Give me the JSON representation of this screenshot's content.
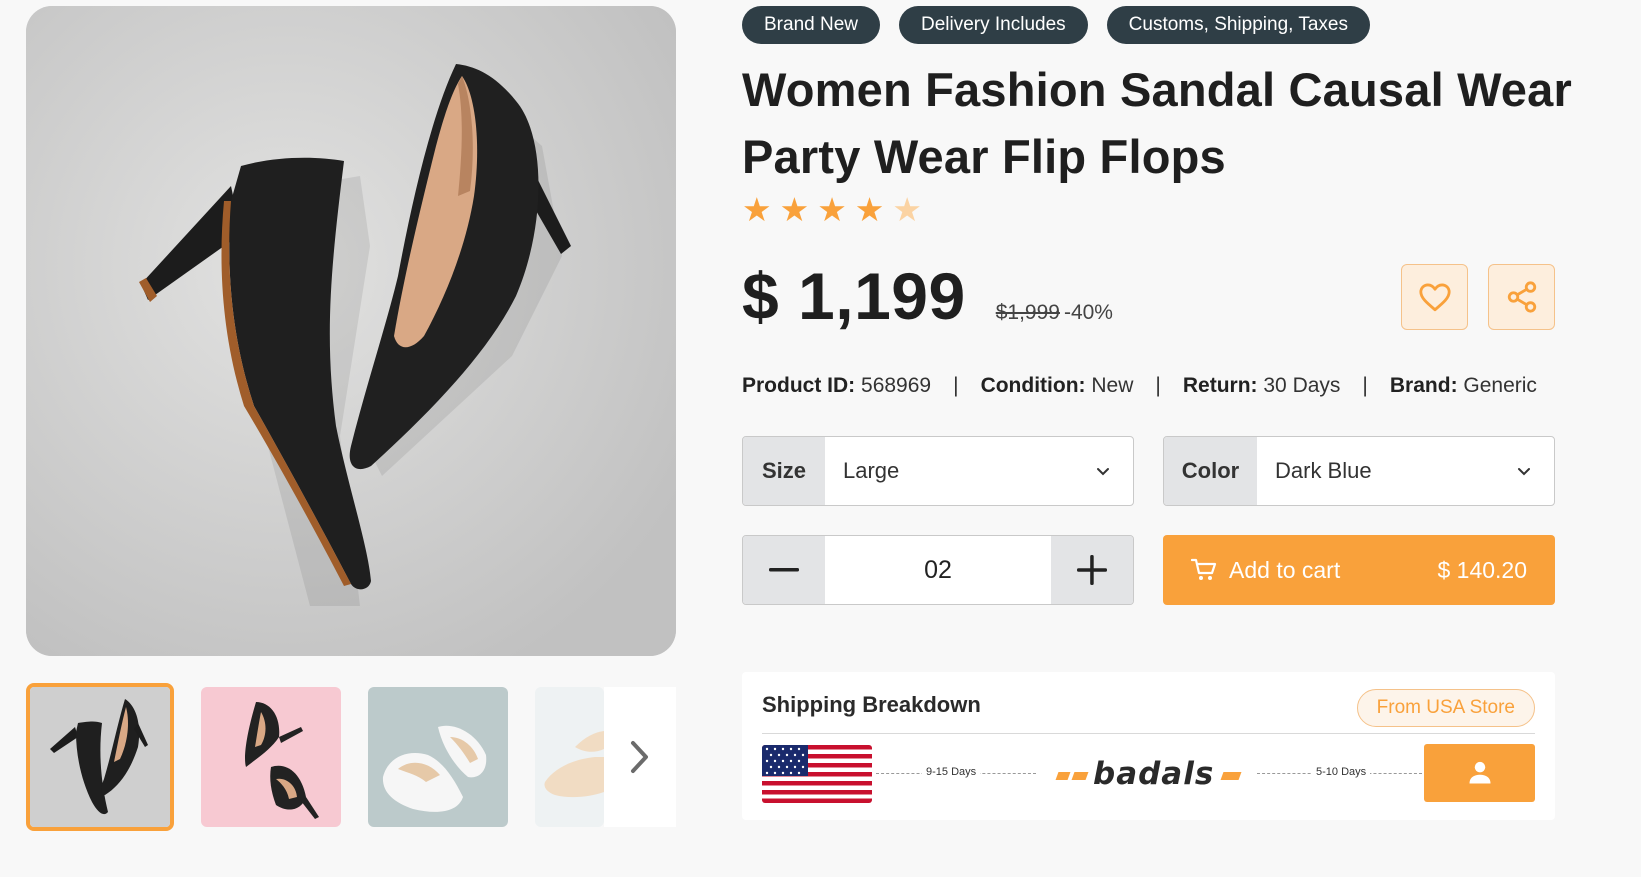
{
  "product": {
    "badges": [
      "Brand New",
      "Delivery Includes",
      "Customs, Shipping, Taxes"
    ],
    "title": "Women Fashion Sandal Causal Wear Party Wear Flip Flops",
    "rating": 4.5,
    "rating_max": 5,
    "price": "$ 1,199",
    "old_price": "$1,999",
    "discount": "-40%",
    "meta": {
      "product_id_label": "Product ID:",
      "product_id": "568969",
      "condition_label": "Condition:",
      "condition": "New",
      "return_label": "Return:",
      "return": "30 Days",
      "brand_label": "Brand:",
      "brand": "Generic",
      "separator": "|"
    }
  },
  "options": {
    "size_label": "Size",
    "size_value": "Large",
    "color_label": "Color",
    "color_value": "Dark Blue"
  },
  "quantity": {
    "value": "02"
  },
  "cart": {
    "label": "Add to cart",
    "amount": "$ 140.20"
  },
  "shipping": {
    "title": "Shipping Breakdown",
    "store": "From USA Store",
    "leg1_days": "9-15 Days",
    "leg2_days": "5-10 Days",
    "logo_text": "badals"
  },
  "thumbnails": [
    "black-heels",
    "black-heels-pink",
    "white-flats",
    "cream-flats"
  ],
  "icons": {
    "wishlist": "heart-icon",
    "share": "share-icon",
    "cart": "cart-icon",
    "next": "chevron-right-icon",
    "user": "user-icon",
    "dropdown": "chevron-down-icon",
    "minus": "minus-icon",
    "plus": "plus-icon",
    "star": "star-icon"
  },
  "colors": {
    "accent": "#f9a13b",
    "badge_bg": "#2f3e46",
    "control_bg": "#e3e4e6"
  }
}
